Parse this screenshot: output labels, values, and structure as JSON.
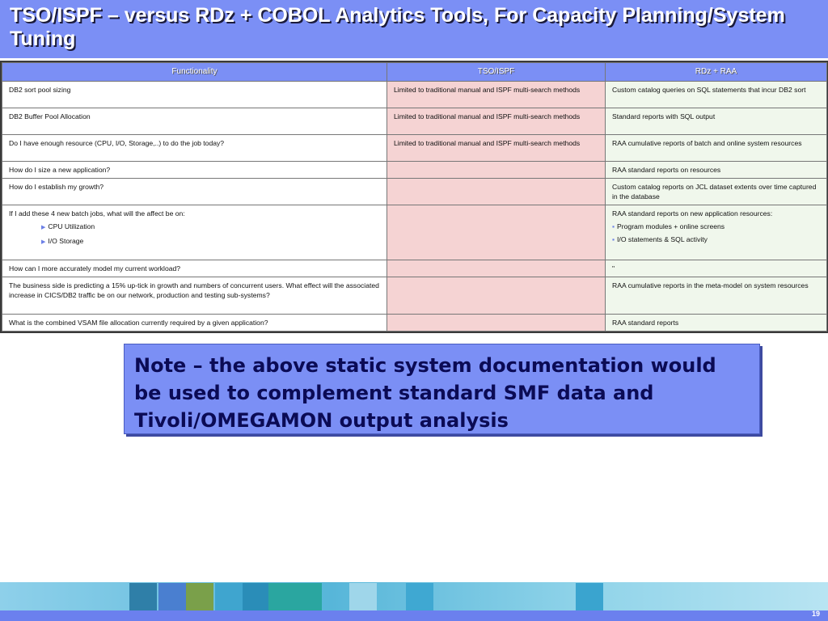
{
  "title": "TSO/ISPF – versus RDz + COBOL Analytics Tools, For Capacity Planning/System Tuning",
  "table": {
    "headers": [
      "Functionality",
      "TSO/ISPF",
      "RDz + RAA"
    ],
    "rows": [
      {
        "functionality": "DB2 sort pool sizing",
        "tso": "Limited to traditional manual and ISPF multi-search methods",
        "rdz": "Custom catalog queries on SQL statements that incur DB2 sort"
      },
      {
        "functionality": "DB2 Buffer Pool Allocation",
        "tso": "Limited to traditional manual and ISPF multi-search methods",
        "rdz": "Standard reports with SQL output"
      },
      {
        "functionality": "Do I have enough resource (CPU, I/O, Storage,..) to do the job today?",
        "tso": "Limited to traditional manual and ISPF multi-search methods",
        "rdz": "RAA cumulative reports of batch and online system resources"
      },
      {
        "functionality": "How do I size a new application?",
        "tso": "",
        "rdz": "RAA standard reports on resources"
      },
      {
        "functionality": "How do I establish my growth?",
        "tso": "",
        "rdz": "Custom catalog reports on JCL dataset extents over time captured in the database"
      },
      {
        "functionality": "If I add these 4 new batch jobs, what will the affect be on:",
        "functionality_sub": [
          "CPU Utilization",
          "I/O Storage"
        ],
        "tso": "",
        "rdz": "RAA standard reports on new application resources:",
        "rdz_sub": [
          "Program modules + online screens",
          "I/O statements & SQL activity"
        ]
      },
      {
        "functionality": "How can I more accurately model my current workload?",
        "tso": "",
        "rdz": "\""
      },
      {
        "functionality": "The business side is predicting a 15% up-tick in growth and numbers of concurrent users.  What effect will the associated increase in CICS/DB2 traffic be on our network, production and testing sub-systems?",
        "tso": "",
        "rdz": "RAA cumulative reports in the meta-model on system resources"
      },
      {
        "functionality": "What is the combined VSAM file allocation currently required by a given application?",
        "tso": "",
        "rdz": "RAA standard reports"
      }
    ]
  },
  "note": "Note – the above static system documentation would be used to complement standard SMF data and Tivoli/OMEGAMON output analysis",
  "page_number": "19",
  "colors": {
    "accent": "#7b8ff5",
    "tso_cell": "#f5d3d3",
    "rdz_cell": "#f0f7ec",
    "note_text": "#0b0b55"
  },
  "icons": [
    "triangle-bullet-icon",
    "square-bullet-icon"
  ]
}
